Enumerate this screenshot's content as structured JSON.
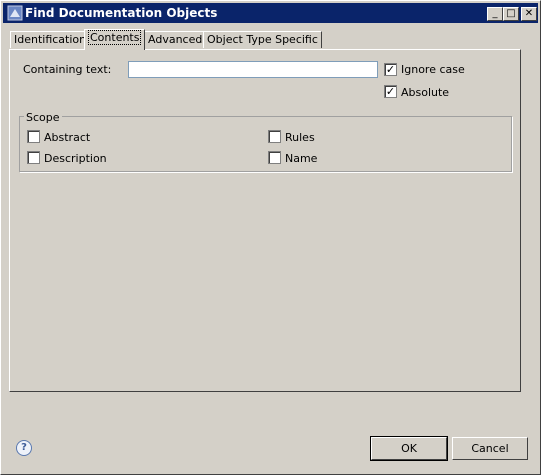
{
  "window": {
    "title": "Find Documentation Objects",
    "minimize_glyph": "_",
    "maximize_glyph": "□",
    "close_glyph": "✕",
    "title_icon": "sparx-app-icon"
  },
  "tabs": [
    {
      "label": "Identification",
      "active": false
    },
    {
      "label": "Contents",
      "active": true
    },
    {
      "label": "Advanced",
      "active": false
    },
    {
      "label": "Object Type Specific",
      "active": false
    }
  ],
  "contents": {
    "containing_text_label": "Containing text:",
    "containing_text_value": "",
    "ignore_case_label": "Ignore case",
    "ignore_case_checked": true,
    "absolute_label": "Absolute",
    "absolute_checked": true,
    "scope": {
      "title": "Scope",
      "abstract_label": "Abstract",
      "abstract_checked": false,
      "rules_label": "Rules",
      "rules_checked": false,
      "description_label": "Description",
      "description_checked": false,
      "name_label": "Name",
      "name_checked": false
    }
  },
  "footer": {
    "help_glyph": "?",
    "ok_label": "OK",
    "cancel_label": "Cancel"
  }
}
